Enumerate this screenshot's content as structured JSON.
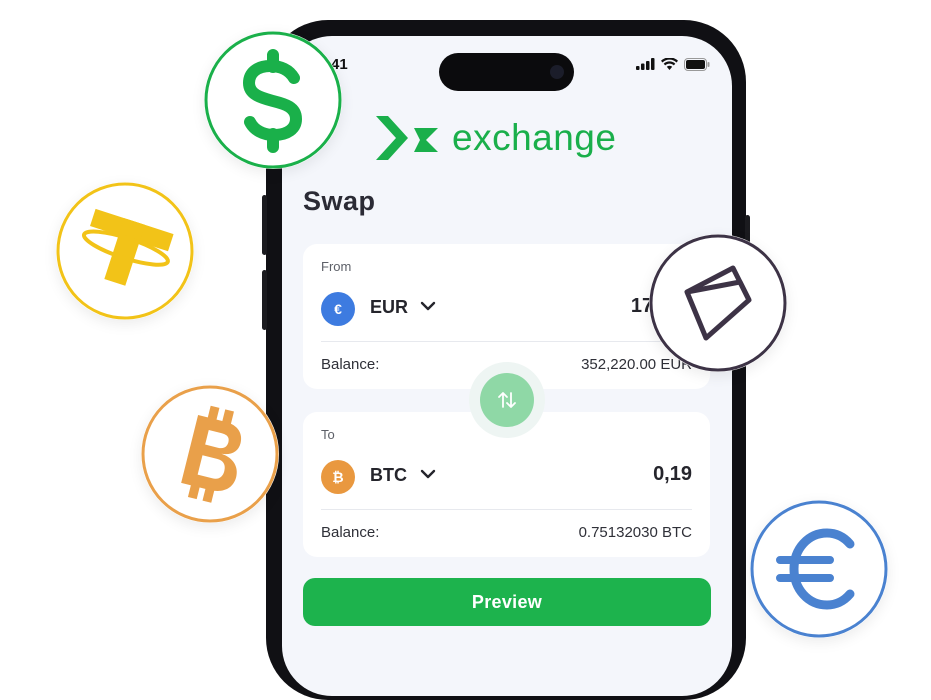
{
  "status_bar": {
    "time": ":41"
  },
  "brand": {
    "name": "exchange",
    "color": "#1aaf4b"
  },
  "page": {
    "title": "Swap"
  },
  "from_card": {
    "label": "From",
    "currency": {
      "code": "EUR",
      "symbol": "€",
      "icon": "euro-coin-icon",
      "color": "#3d7be0"
    },
    "amount": "17,000",
    "balance_label": "Balance:",
    "balance_value": "352,220.00 EUR"
  },
  "to_card": {
    "label": "To",
    "currency": {
      "code": "BTC",
      "symbol": "₿",
      "icon": "bitcoin-coin-icon",
      "color": "#e9983f"
    },
    "amount": "0,19",
    "balance_label": "Balance:",
    "balance_value": "0.75132030 BTC"
  },
  "swap_button": {
    "icon": "swap-arrows-icon",
    "color": "#8fd8a6"
  },
  "preview_button": {
    "label": "Preview",
    "color": "#1db34d"
  },
  "floating_badges": [
    {
      "icon": "dollar-icon",
      "color": "#1ab04a"
    },
    {
      "icon": "tether-icon",
      "color": "#f2c318"
    },
    {
      "icon": "bitcoin-icon",
      "color": "#e9a04a"
    },
    {
      "icon": "ethereum-gem-icon",
      "color": "#3d3346"
    },
    {
      "icon": "euro-icon",
      "color": "#4a82d0"
    }
  ]
}
